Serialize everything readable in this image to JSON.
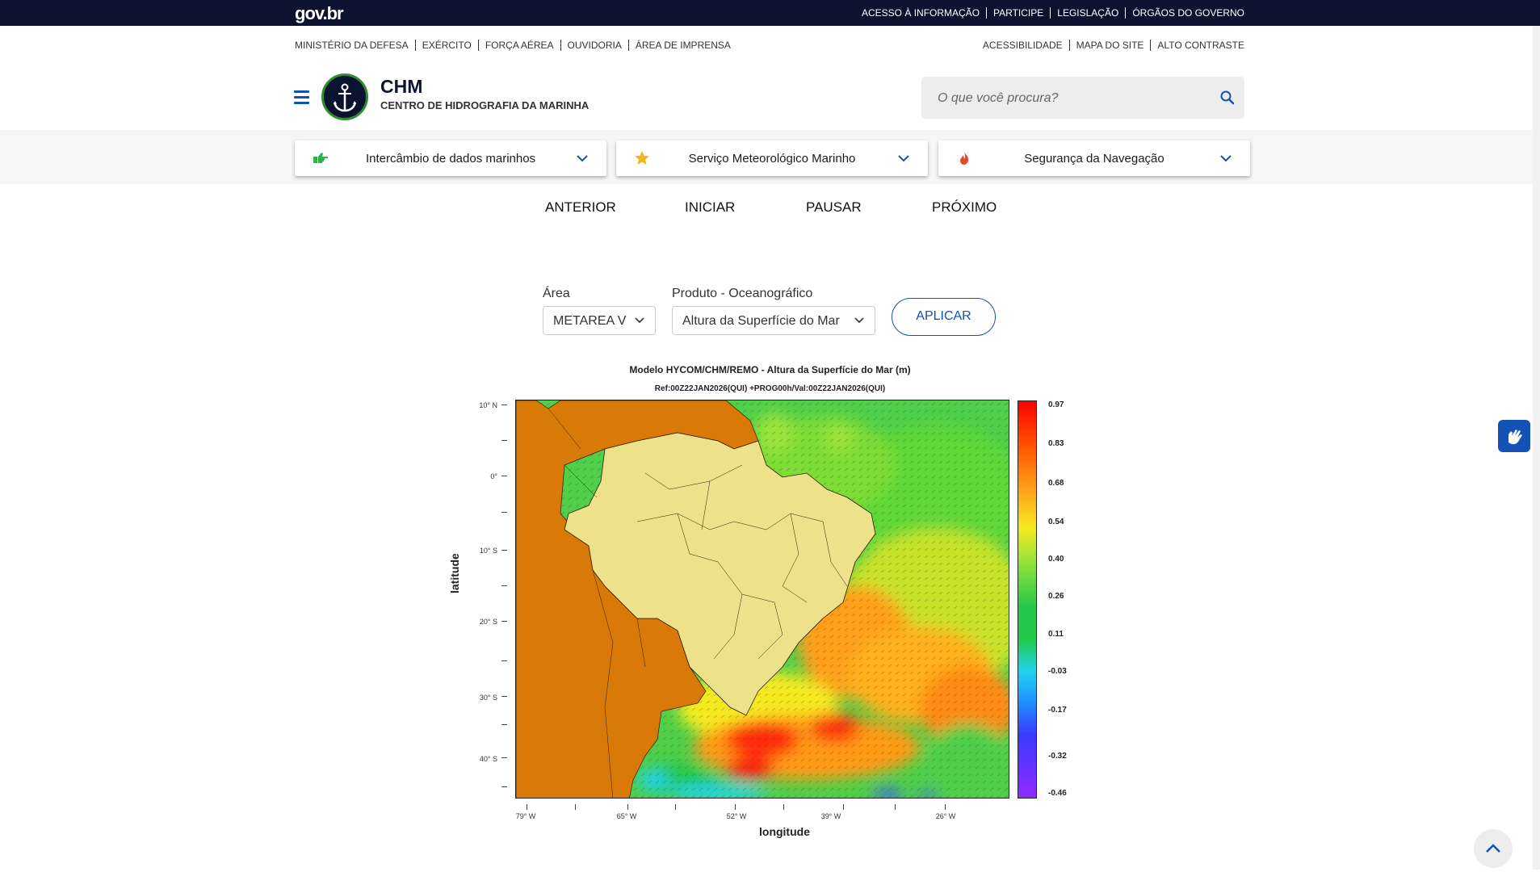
{
  "govbar": {
    "logo": "gov.br",
    "links": [
      "ACESSO À INFORMAÇÃO",
      "PARTICIPE",
      "LEGISLAÇÃO",
      "ÓRGÃOS DO GOVERNO"
    ]
  },
  "secondary_nav": {
    "left": [
      "MINISTÉRIO DA DEFESA",
      "EXÉRCITO",
      "FORÇA AÉREA",
      "OUVIDORIA",
      "ÁREA DE IMPRENSA"
    ],
    "right": [
      "ACESSIBILIDADE",
      "MAPA DO SITE",
      "ALTO CONTRASTE"
    ]
  },
  "header": {
    "title": "CHM",
    "subtitle": "CENTRO DE HIDROGRAFIA DA MARINHA",
    "logo_icon": "anchor-icon",
    "menu_icon": "hamburger-icon"
  },
  "search": {
    "placeholder": "O que você procura?",
    "icon": "search-icon"
  },
  "menus": [
    {
      "label": "Intercâmbio de dados marinhos",
      "icon": "pointing-hand-icon",
      "icon_color": "#2cb34a"
    },
    {
      "label": "Serviço Meteorológico Marinho",
      "icon": "star-icon",
      "icon_color": "#f2b41b"
    },
    {
      "label": "Segurança da Navegação",
      "icon": "flame-icon",
      "icon_color": "#e8492b"
    }
  ],
  "controls": {
    "prev": "ANTERIOR",
    "start": "INICIAR",
    "pause": "PAUSAR",
    "next": "PRÓXIMO"
  },
  "filters": {
    "area_label": "Área",
    "area_value": "METAREA V",
    "product_label": "Produto - Oceanográfico",
    "product_value": "Altura da Superfície do Mar",
    "apply": "APLICAR"
  },
  "figure": {
    "title": "Modelo HYCOM/CHM/REMO - Altura da Superfície do Mar (m)",
    "subtitle": "Ref:00Z22JAN2026(QUI) +PROG00h/Val:00Z22JAN2026(QUI)",
    "xlabel": "longitude",
    "ylabel": "latitude",
    "lat_labels": [
      "10° N",
      "0°",
      "10° S",
      "20° S",
      "30° S",
      "40° S"
    ],
    "lon_labels": [
      "79° W",
      "65° W",
      "52° W",
      "39° W",
      "26° W"
    ],
    "colorbar_labels": [
      "0.97",
      "0.83",
      "0.68",
      "0.54",
      "0.40",
      "0.26",
      "0.11",
      "-0.03",
      "-0.17",
      "-0.32",
      "-0.46"
    ],
    "land_colors": {
      "brazil": "#ede28a",
      "neighbors": "#d97a08"
    },
    "sea_colors": [
      "#8f2bff",
      "#3b5bff",
      "#22d3ee",
      "#22c84a",
      "#9be33a",
      "#f5ea20",
      "#ff9f1a",
      "#ff2b0a"
    ]
  },
  "floating": {
    "libras_icon": "sign-language-icon",
    "back_to_top_icon": "chevron-up-icon"
  }
}
